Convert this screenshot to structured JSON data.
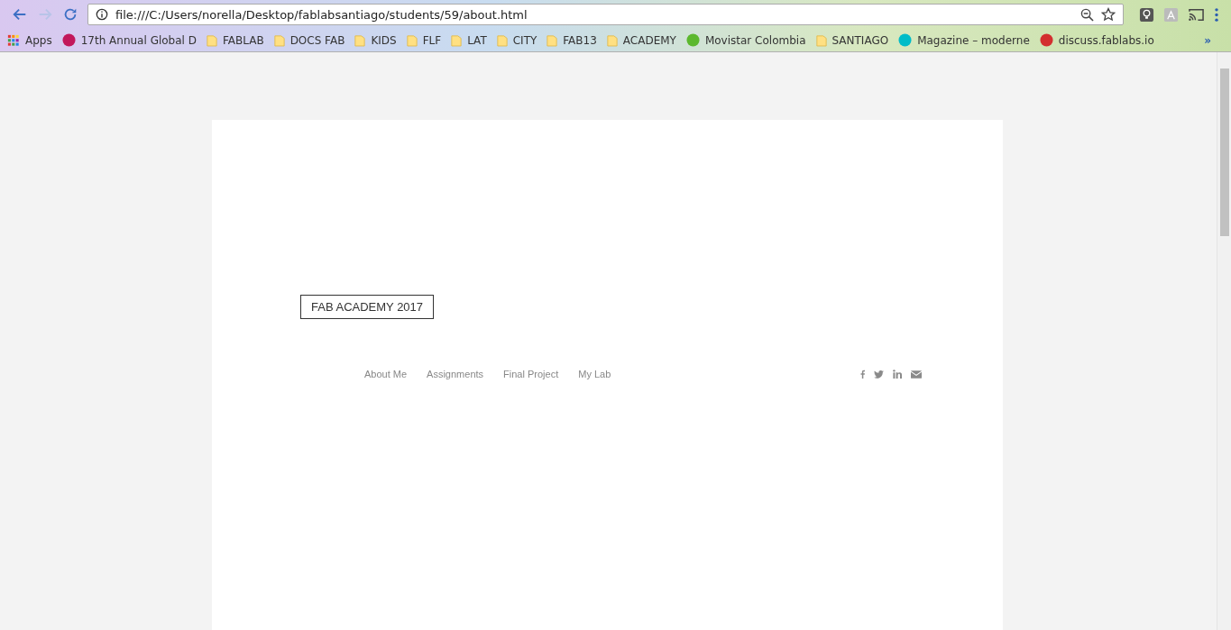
{
  "browser": {
    "url": "file:///C:/Users/norella/Desktop/fablabsantiago/students/59/about.html",
    "bookmarks": [
      {
        "kind": "apps",
        "label": "Apps"
      },
      {
        "kind": "site",
        "label": "17th Annual Global D",
        "color": "#c2185b"
      },
      {
        "kind": "folder",
        "label": "FABLAB"
      },
      {
        "kind": "folder",
        "label": "DOCS FAB"
      },
      {
        "kind": "folder",
        "label": "KIDS"
      },
      {
        "kind": "folder",
        "label": "FLF"
      },
      {
        "kind": "folder",
        "label": "LAT"
      },
      {
        "kind": "folder",
        "label": "CITY"
      },
      {
        "kind": "folder",
        "label": "FAB13"
      },
      {
        "kind": "folder",
        "label": "ACADEMY"
      },
      {
        "kind": "site",
        "label": "Movistar Colombia",
        "color": "#5cb82e"
      },
      {
        "kind": "folder",
        "label": "SANTIAGO"
      },
      {
        "kind": "site",
        "label": "Magazine – moderne",
        "color": "#00bcc8"
      },
      {
        "kind": "site",
        "label": "discuss.fablabs.io",
        "color": "#d32f2f"
      }
    ],
    "overflow": "»"
  },
  "page": {
    "badge": "FAB ACADEMY 2017",
    "nav": [
      "About Me",
      "Assignments",
      "Final Project",
      "My Lab"
    ],
    "social": [
      {
        "kind": "facebook"
      },
      {
        "kind": "twitter"
      },
      {
        "kind": "linkedin"
      },
      {
        "kind": "email"
      }
    ]
  }
}
